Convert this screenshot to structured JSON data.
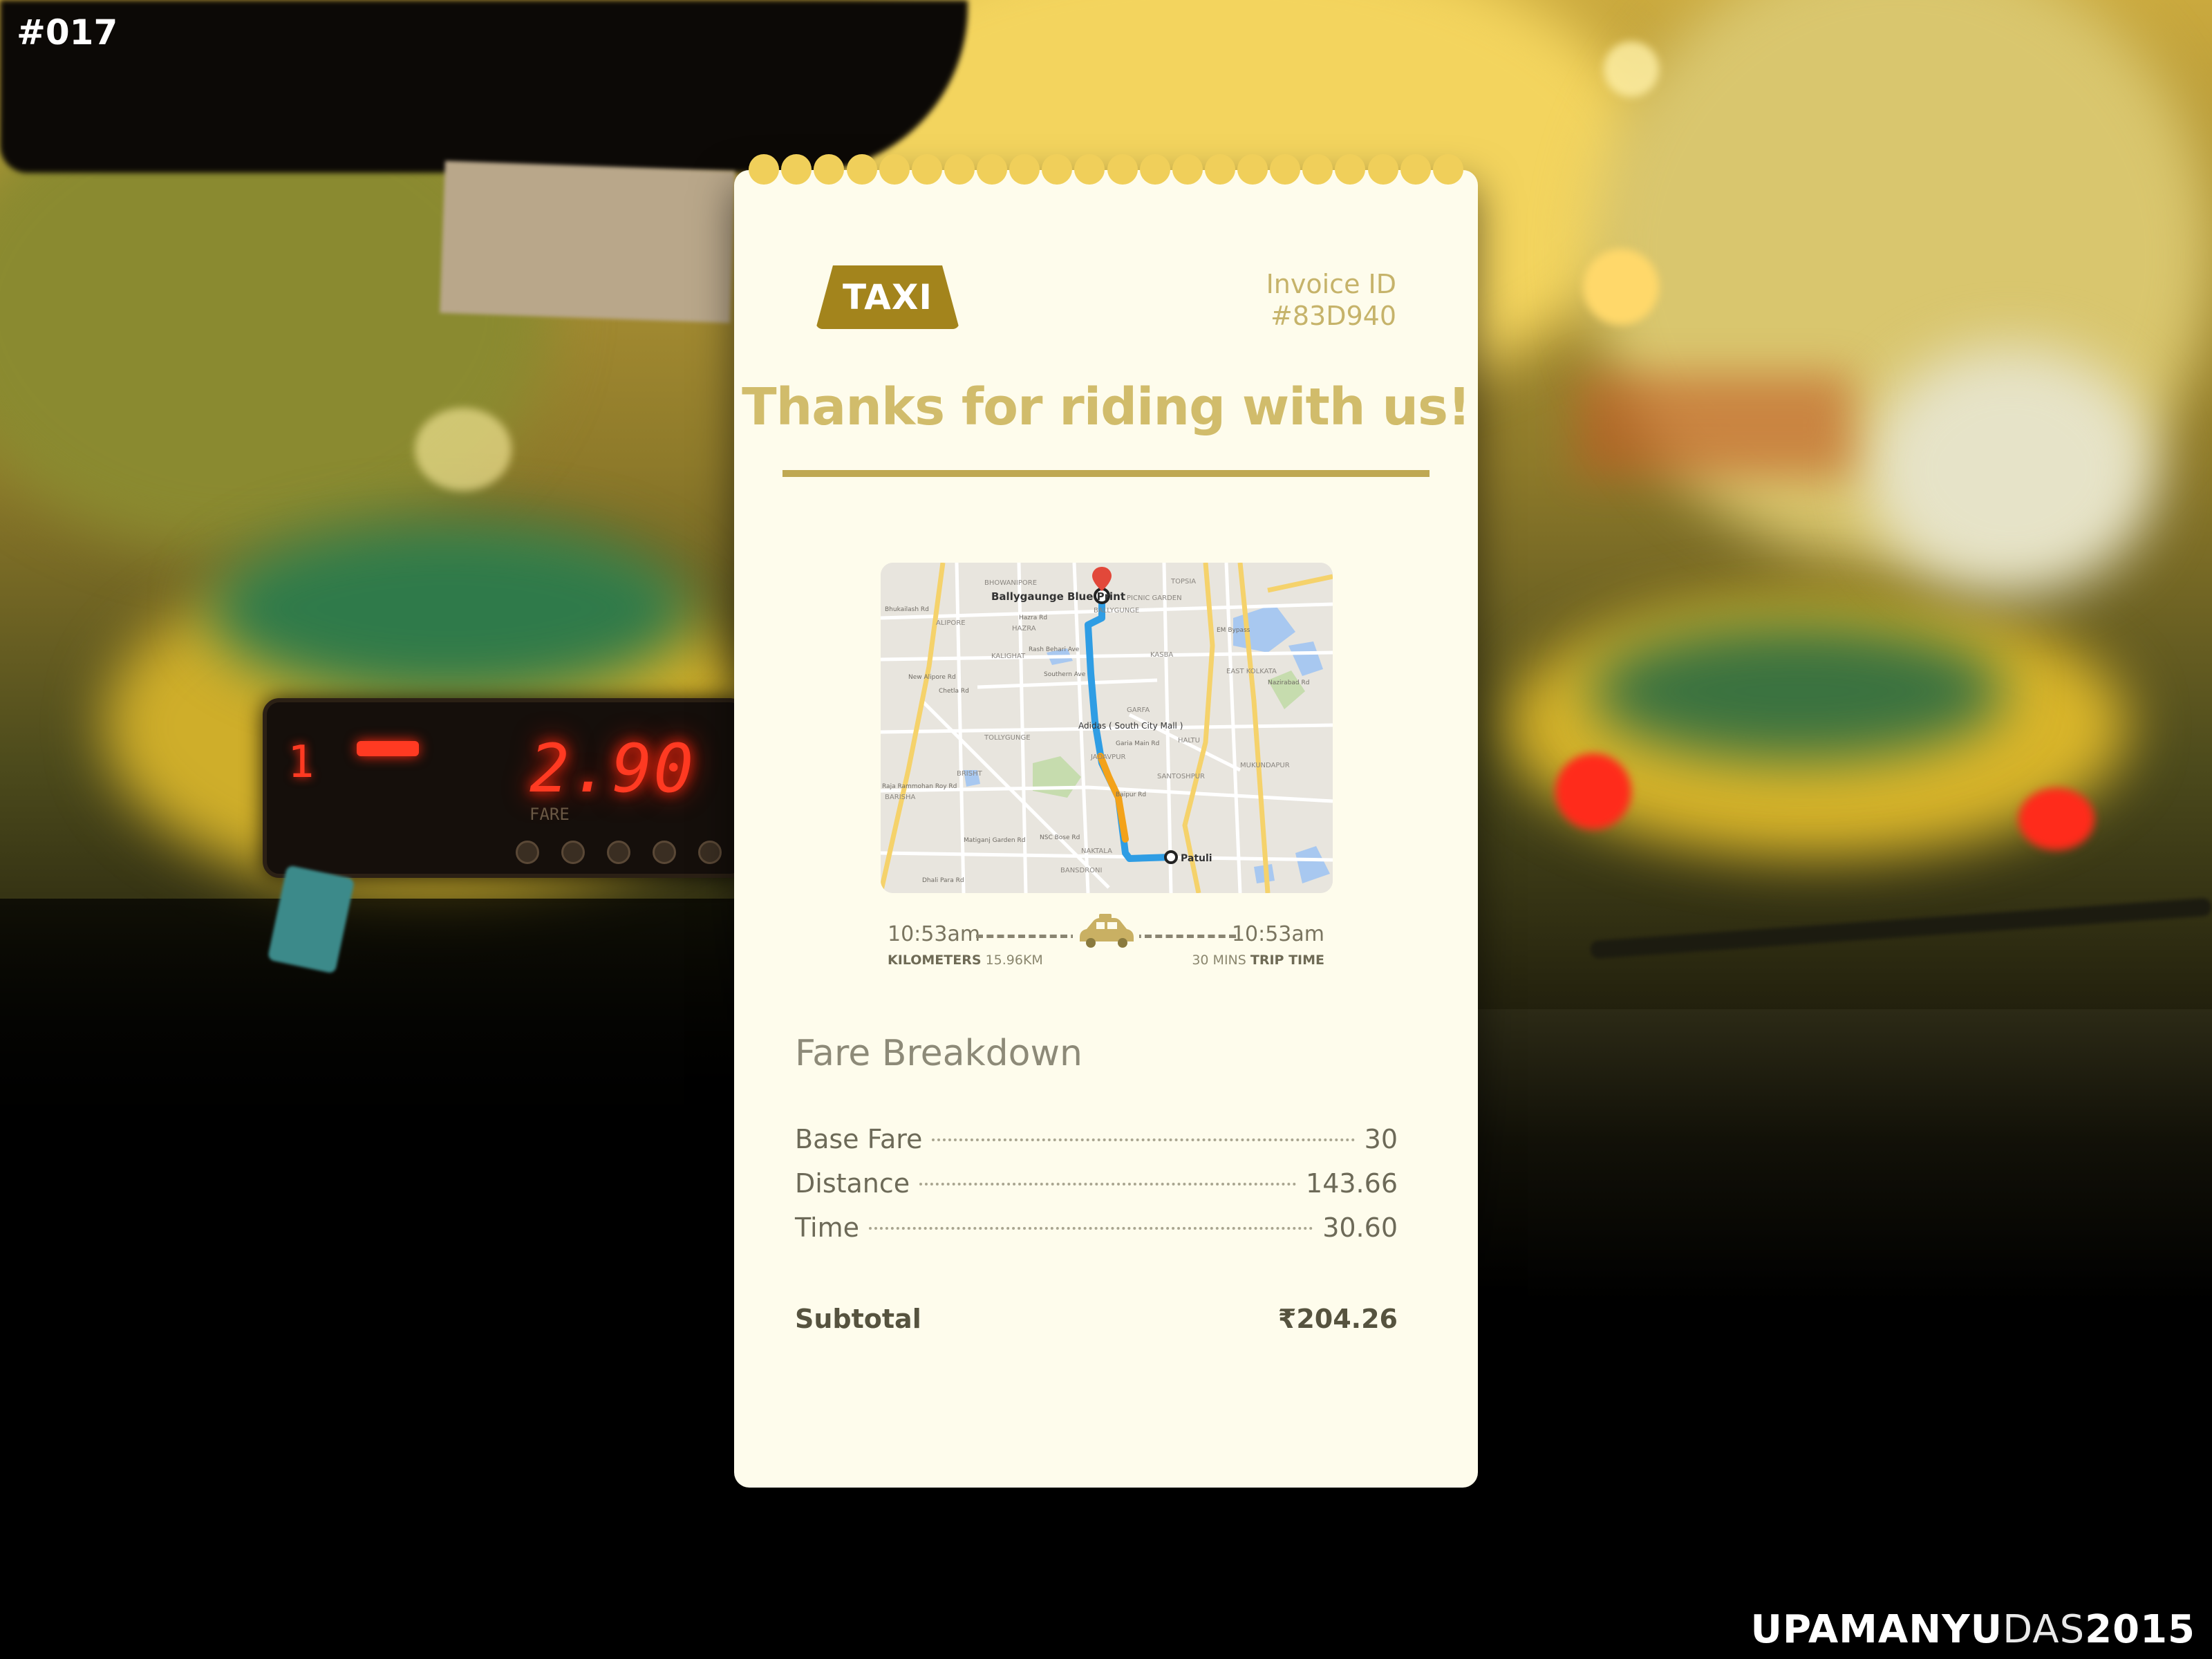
{
  "shot_number": "#017",
  "signature": {
    "first": "UPAMANYU",
    "last": "DAS",
    "year": "2015"
  },
  "meter": {
    "small_digit": "1",
    "fare_display": "2.90",
    "fare_label": "FARE"
  },
  "receipt": {
    "badge": "TAXI",
    "invoice_label": "Invoice ID",
    "invoice_id": "#83D940",
    "headline": "Thanks for riding with us!",
    "map": {
      "pickup": "Ballygaunge Blue Print",
      "midpoint": "Adidas ( South City Mall )",
      "dropoff": "Patuli",
      "area_labels": [
        "BHOWANIPORE",
        "BALLYGUNGE",
        "TOPSIA",
        "PICNIC GARDEN",
        "HAZRA",
        "ALIPORE",
        "KALIGHAT",
        "KASBA",
        "EAST KOLKATA",
        "GARFA",
        "HALTU",
        "TOLLYGUNGE",
        "JADAVPUR",
        "SANTOSHPUR",
        "MUKUNDAPUR",
        "BRISHT",
        "BARISHA",
        "NAKTALA",
        "BANSDRONI"
      ],
      "road_labels": [
        "Bhukailash Rd",
        "Hazra Rd",
        "Rash Behari Ave",
        "Southern Ave",
        "New Alipore Rd",
        "Garia Main Rd",
        "Nazirabad Rd",
        "EM Bypass",
        "Baipur Rd",
        "Raja Rammohan Roy Rd",
        "NSC Bose Rd",
        "Dhali Para Rd",
        "Matiganj Garden Rd",
        "Chetla Rd"
      ]
    },
    "trip": {
      "start_time": "10:53am",
      "end_time": "10:53am",
      "distance_label": "KILOMETERS",
      "distance_value": "15.96KM",
      "duration_value": "30 MINS",
      "duration_label": "TRIP TIME"
    },
    "fare_title": "Fare Breakdown",
    "fares": [
      {
        "label": "Base Fare",
        "amount": "30"
      },
      {
        "label": "Distance",
        "amount": "143.66"
      },
      {
        "label": "Time",
        "amount": "30.60"
      }
    ],
    "subtotal_label": "Subtotal",
    "subtotal_currency": "₹",
    "subtotal_value": "204.26"
  },
  "colors": {
    "card_bg": "#fefcec",
    "accent_gold": "#a3841c",
    "headline_gold": "#d1bc6b",
    "scallop_yellow": "#f0cf5a",
    "route_blue": "#2f9de4",
    "route_orange": "#f3a21a",
    "meter_red": "#ff3a22"
  }
}
